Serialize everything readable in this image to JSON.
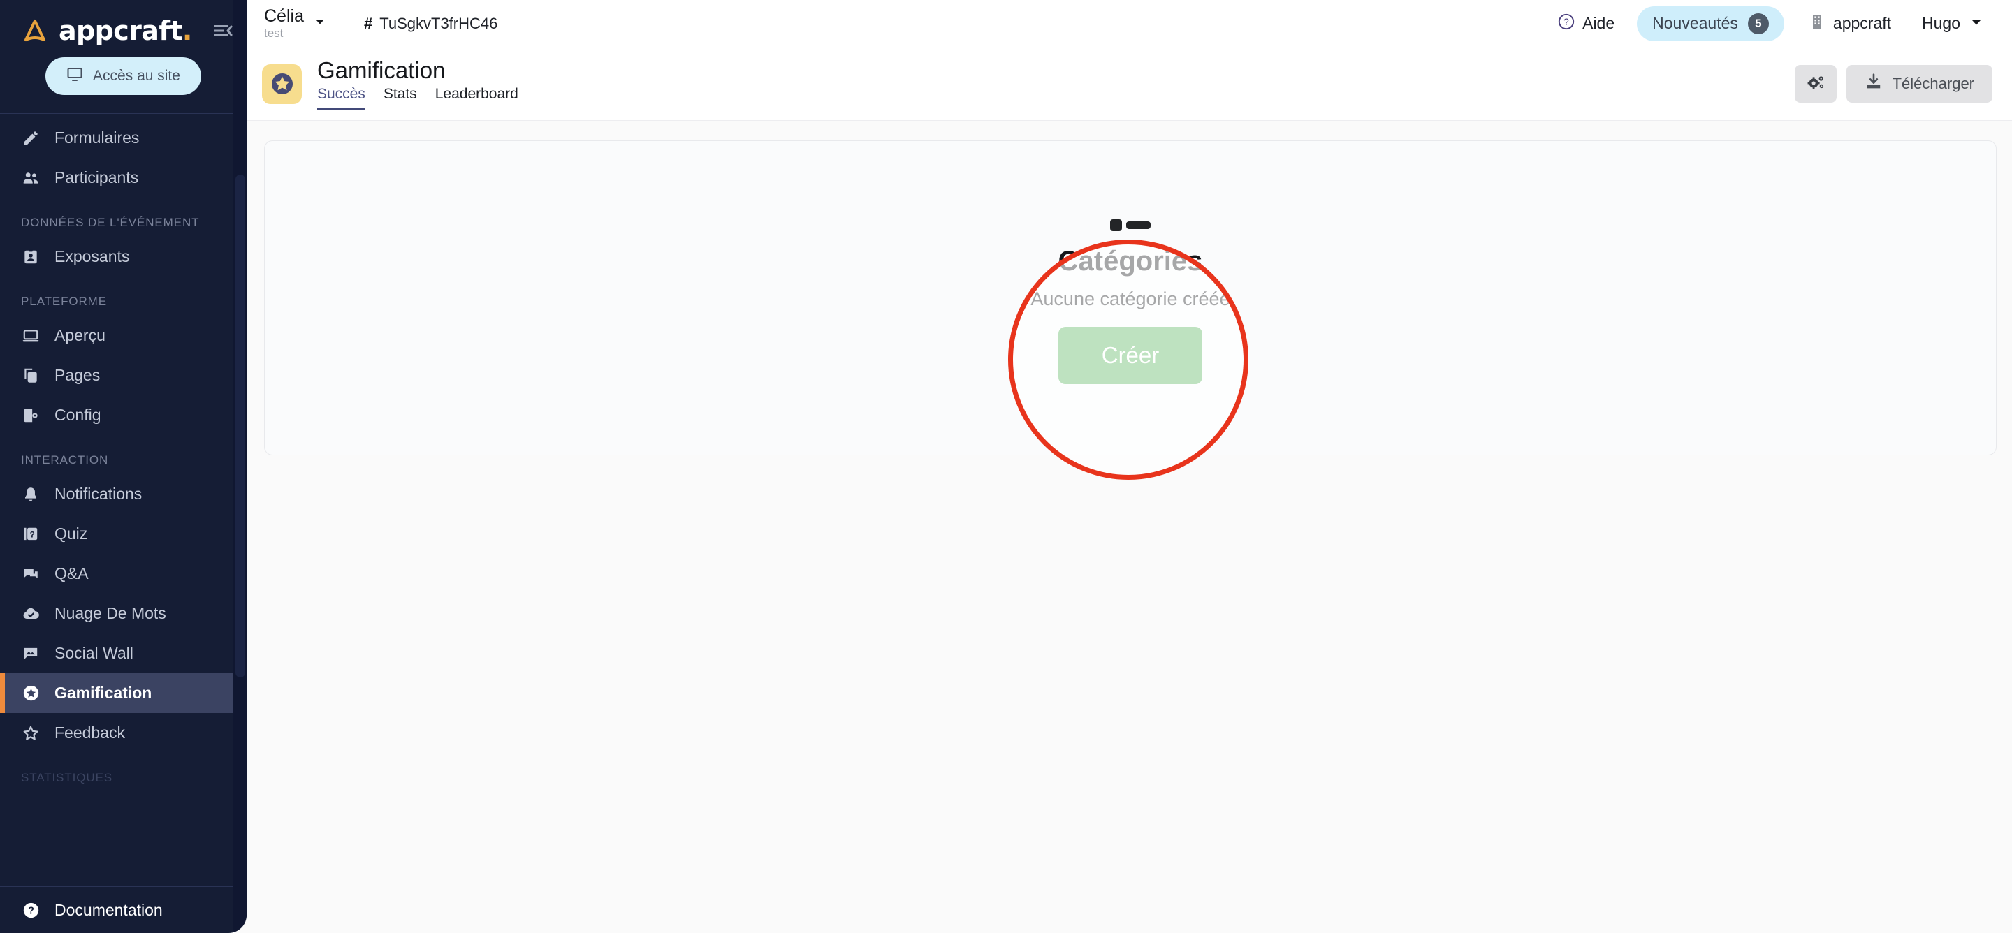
{
  "brand": {
    "wordmark": "appcraft",
    "dot": ".",
    "logo_icon": "appcraft-delta-logo",
    "collapse_icon": "collapse-sidebar-icon",
    "accent_color": "#e8a33d"
  },
  "sidebar": {
    "site_access": {
      "label": "Accès au site",
      "icon": "monitor-icon"
    },
    "groups": [
      {
        "header": null,
        "items": [
          {
            "label": "Formulaires",
            "icon": "pencil-icon",
            "active": false
          },
          {
            "label": "Participants",
            "icon": "people-icon",
            "active": false
          }
        ]
      },
      {
        "header": "DONNÉES DE L'ÉVÉNEMENT",
        "items": [
          {
            "label": "Exposants",
            "icon": "badge-icon",
            "active": false
          }
        ]
      },
      {
        "header": "PLATEFORME",
        "items": [
          {
            "label": "Aperçu",
            "icon": "laptop-icon",
            "active": false
          },
          {
            "label": "Pages",
            "icon": "copy-pages-icon",
            "active": false
          },
          {
            "label": "Config",
            "icon": "phone-gear-icon",
            "active": false
          }
        ]
      },
      {
        "header": "INTERACTION",
        "items": [
          {
            "label": "Notifications",
            "icon": "bell-icon",
            "active": false
          },
          {
            "label": "Quiz",
            "icon": "question-card-icon",
            "active": false
          },
          {
            "label": "Q&A",
            "icon": "chat-bubbles-icon",
            "active": false
          },
          {
            "label": "Nuage De Mots",
            "icon": "cloud-check-icon",
            "active": false
          },
          {
            "label": "Social Wall",
            "icon": "photo-bubble-icon",
            "active": false
          },
          {
            "label": "Gamification",
            "icon": "star-circle-icon",
            "active": true
          },
          {
            "label": "Feedback",
            "icon": "star-outline-icon",
            "active": false
          }
        ]
      },
      {
        "header": "STATISTIQUES",
        "items": []
      }
    ],
    "footer": {
      "label": "Documentation",
      "icon": "help-circle-icon"
    },
    "active_accent_color": "#ef8b3c",
    "background_color": "#151d35"
  },
  "topbar": {
    "event": {
      "name": "Célia",
      "subtitle": "test",
      "caret_icon": "chevron-down-icon"
    },
    "code": {
      "hash": "#",
      "value": "TuSgkvT3frHC46"
    },
    "help": {
      "label": "Aide",
      "icon": "help-circle-icon"
    },
    "news": {
      "label": "Nouveautés",
      "count": "5",
      "pill_color": "#cfeefb"
    },
    "org": {
      "label": "appcraft",
      "icon": "building-icon"
    },
    "user": {
      "label": "Hugo",
      "caret_icon": "chevron-down-icon"
    }
  },
  "page_header": {
    "icon": "star-badge-icon",
    "icon_bg_color": "#f7dd8e",
    "title": "Gamification",
    "tabs": [
      {
        "label": "Succès",
        "active": true
      },
      {
        "label": "Stats",
        "active": false
      },
      {
        "label": "Leaderboard",
        "active": false
      }
    ],
    "actions": {
      "settings": {
        "icon": "gears-icon"
      },
      "download": {
        "label": "Télécharger",
        "icon": "download-icon"
      }
    },
    "active_tab_color": "#434a79"
  },
  "main": {
    "empty_state": {
      "icon": "category-list-icon",
      "title": "Catégories",
      "subtitle": "Aucune catégorie créée",
      "create_button": {
        "label": "Créer",
        "color": "#56b45a"
      }
    }
  },
  "annotation": {
    "shape": "circle-highlight",
    "color": "#e8341c"
  }
}
